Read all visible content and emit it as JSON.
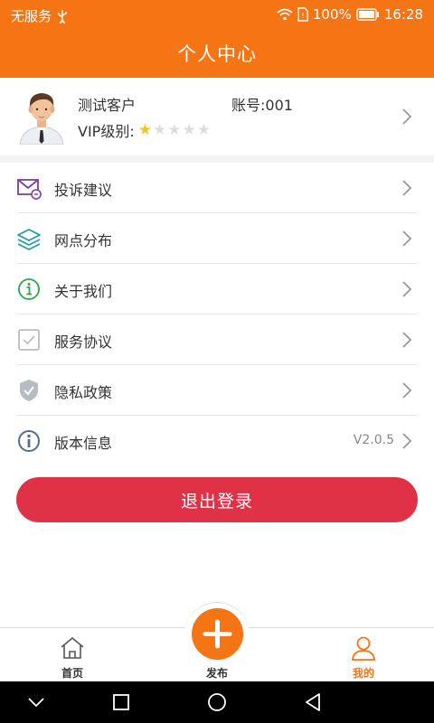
{
  "status_bar": {
    "carrier": "无服务",
    "battery": "100%",
    "time": "16:28"
  },
  "header": {
    "title": "个人中心"
  },
  "profile": {
    "name": "测试客户",
    "account": "账号:001",
    "vip_label": "VIP级别:",
    "vip_stars": 1,
    "vip_stars_max": 5
  },
  "menu": {
    "items": [
      {
        "label": "投诉建议",
        "icon": "mail-icon"
      },
      {
        "label": "网点分布",
        "icon": "layers-icon"
      },
      {
        "label": "关于我们",
        "icon": "info-icon"
      },
      {
        "label": "服务协议",
        "icon": "checkbox-icon"
      },
      {
        "label": "隐私政策",
        "icon": "shield-icon"
      },
      {
        "label": "版本信息",
        "icon": "info-circle-icon",
        "value": "V2.0.5"
      }
    ]
  },
  "logout_label": "退出登录",
  "tabbar": {
    "home": "首页",
    "publish": "发布",
    "mine": "我的"
  },
  "colors": {
    "primary": "#f57514",
    "logout": "#e03247",
    "star_active": "#f5c518",
    "star_inactive": "#dddddd"
  }
}
